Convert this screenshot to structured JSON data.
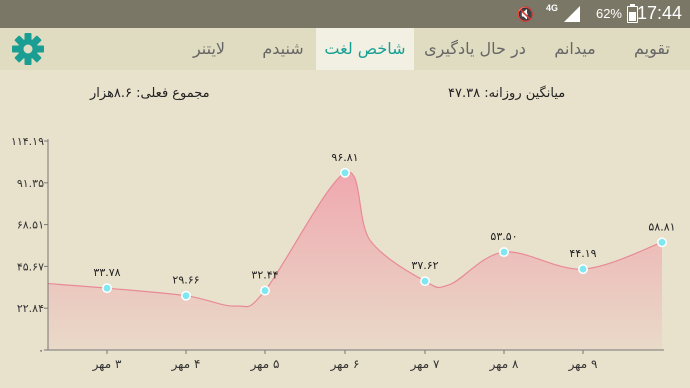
{
  "status_bar": {
    "time": "17:44",
    "battery": "62%",
    "network": "4G",
    "icons": [
      "mute-icon",
      "signal-icon",
      "battery-icon"
    ]
  },
  "tabs": [
    {
      "label": "تقویم",
      "active": false
    },
    {
      "label": "میدانم",
      "active": false
    },
    {
      "label": "در حال یادگیری",
      "active": false
    },
    {
      "label": "شاخص لغت",
      "active": true
    },
    {
      "label": "شنیدم",
      "active": false
    },
    {
      "label": "لایتنر",
      "active": false
    }
  ],
  "header": {
    "daily_average": "میانگین روزانه: ۴۷.۳۸",
    "current_total": "مجموع فعلی: ۸.۶هزار"
  },
  "colors": {
    "accent": "#169f93",
    "area_fill": "#f0a5ae",
    "point": "#7ee7f0"
  },
  "chart_data": {
    "type": "area",
    "x": [
      "۳ مهر",
      "۴ مهر",
      "۵ مهر",
      "۶ مهر",
      "۷ مهر",
      "۸ مهر",
      "۹ مهر"
    ],
    "values": [
      33.78,
      29.66,
      32.44,
      96.81,
      37.62,
      53.5,
      44.19,
      58.81
    ],
    "labels": [
      "۳۳.۷۸",
      "۲۹.۶۶",
      "۳۲.۴۴",
      "۹۶.۸۱",
      "۳۷.۶۲",
      "۵۳.۵۰",
      "۴۴.۱۹",
      "۵۸.۸۱"
    ],
    "y_ticks": [
      0,
      22.84,
      45.67,
      68.51,
      91.35,
      114.19
    ],
    "y_tick_labels": [
      "۰",
      "۲۲.۸۴",
      "۴۵.۶۷",
      "۶۸.۵۱",
      "۹۱.۳۵",
      "۱۱۴.۱۹"
    ],
    "ylim": [
      0,
      114.19
    ],
    "grid": false,
    "legend": "none"
  }
}
